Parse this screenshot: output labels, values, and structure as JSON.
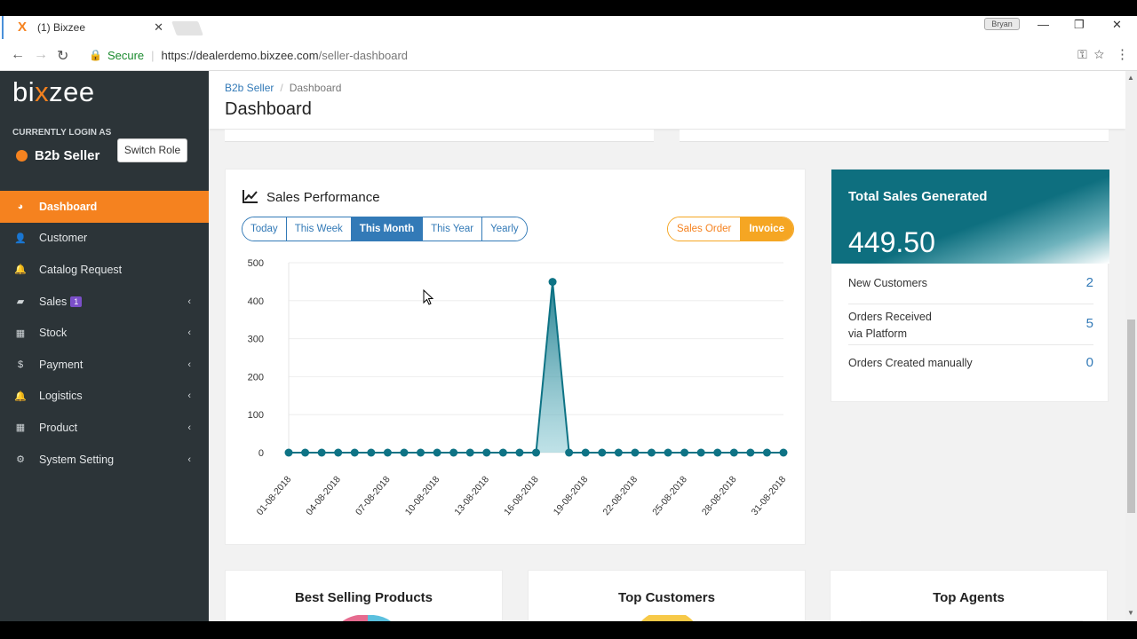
{
  "browser": {
    "tab_title": "(1) Bixzee",
    "profile_name": "Bryan",
    "secure_label": "Secure",
    "url_host": "https://dealerdemo.bixzee.com",
    "url_path": "/seller-dashboard"
  },
  "sidebar": {
    "logo": {
      "pre": "bi",
      "x": "x",
      "post": "zee"
    },
    "login_label": "CURRENTLY LOGIN AS",
    "role_name": "B2b Seller",
    "switch_role": "Switch Role",
    "items": [
      {
        "label": "Dashboard",
        "icon": "dashboard-icon",
        "glyph": "◕",
        "active": true
      },
      {
        "label": "Customer",
        "icon": "user-icon",
        "glyph": "👤"
      },
      {
        "label": "Catalog Request",
        "icon": "bell-icon",
        "glyph": "🔔"
      },
      {
        "label": "Sales",
        "icon": "book-icon",
        "glyph": "▰",
        "badge": "1",
        "chevron": true
      },
      {
        "label": "Stock",
        "icon": "cubes-icon",
        "glyph": "▦",
        "chevron": true
      },
      {
        "label": "Payment",
        "icon": "dollar-icon",
        "glyph": "$",
        "chevron": true
      },
      {
        "label": "Logistics",
        "icon": "bell-icon",
        "glyph": "🔔",
        "chevron": true
      },
      {
        "label": "Product",
        "icon": "cubes-icon",
        "glyph": "▦",
        "chevron": true
      },
      {
        "label": "System Setting",
        "icon": "gears-icon",
        "glyph": "⚙",
        "chevron": true
      }
    ]
  },
  "header": {
    "breadcrumb_1": "B2b Seller",
    "breadcrumb_2": "Dashboard",
    "title": "Dashboard"
  },
  "performance": {
    "title": "Sales Performance",
    "periods": [
      "Today",
      "This Week",
      "This Month",
      "This Year",
      "Yearly"
    ],
    "active_period": "This Month",
    "types": [
      "Sales Order",
      "Invoice"
    ],
    "active_type": "Invoice"
  },
  "chart_data": {
    "type": "area",
    "x": [
      "01-08-2018",
      "02-08-2018",
      "03-08-2018",
      "04-08-2018",
      "05-08-2018",
      "06-08-2018",
      "07-08-2018",
      "08-08-2018",
      "09-08-2018",
      "10-08-2018",
      "11-08-2018",
      "12-08-2018",
      "13-08-2018",
      "14-08-2018",
      "15-08-2018",
      "16-08-2018",
      "17-08-2018",
      "18-08-2018",
      "19-08-2018",
      "20-08-2018",
      "21-08-2018",
      "22-08-2018",
      "23-08-2018",
      "24-08-2018",
      "25-08-2018",
      "26-08-2018",
      "27-08-2018",
      "28-08-2018",
      "29-08-2018",
      "30-08-2018",
      "31-08-2018"
    ],
    "values": [
      0,
      0,
      0,
      0,
      0,
      0,
      0,
      0,
      0,
      0,
      0,
      0,
      0,
      0,
      0,
      0,
      449.5,
      0,
      0,
      0,
      0,
      0,
      0,
      0,
      0,
      0,
      0,
      0,
      0,
      0,
      0
    ],
    "xtick_labels": [
      "01-08-2018",
      "04-08-2018",
      "07-08-2018",
      "10-08-2018",
      "13-08-2018",
      "16-08-2018",
      "19-08-2018",
      "22-08-2018",
      "25-08-2018",
      "28-08-2018",
      "31-08-2018"
    ],
    "yticks": [
      0,
      100,
      200,
      300,
      400,
      500
    ],
    "ylim": [
      0,
      500
    ],
    "color": "#0e7385",
    "grid": true
  },
  "sales_summary": {
    "title": "Total Sales Generated",
    "total": "449.50",
    "rows": [
      {
        "label": "New Customers",
        "value": "2"
      },
      {
        "label": "Orders Received\nvia Platform",
        "value": "5"
      },
      {
        "label": "Orders Created manually",
        "value": "0"
      }
    ]
  },
  "bottom_cards": [
    "Best Selling Products",
    "Top Customers",
    "Top Agents"
  ],
  "colors": {
    "accent": "#f5821f",
    "primary": "#337ab7",
    "teal": "#0e6f7f",
    "sidebar": "#2c3438"
  }
}
